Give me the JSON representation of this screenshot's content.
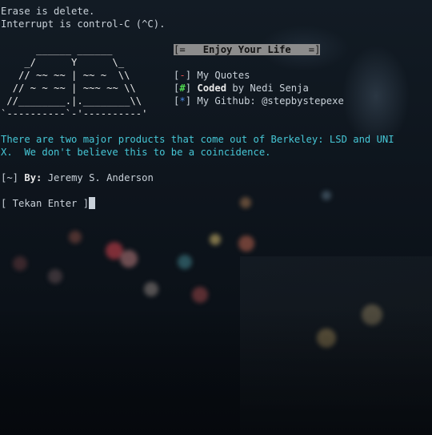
{
  "terminal": {
    "line1": "Erase is delete.",
    "line2": "Interrupt is control-C (^C).",
    "ascii_art": [
      "      ______ ______",
      "    _/      Y      \\_",
      "   // ~~ ~~ | ~~ ~  \\\\",
      "  // ~ ~ ~~ | ~~~ ~~ \\\\",
      " //________.|.________\\\\",
      "`----------`-'----------'"
    ],
    "banner": {
      "open": "[=",
      "title": "Enjoy Your Life",
      "close": "=]"
    },
    "menu": [
      {
        "bracket_open": "[",
        "mark": "-",
        "bracket_close": "]",
        "label": "My Quotes",
        "mark_color": "#e04a4a"
      },
      {
        "bracket_open": "[",
        "mark": "#",
        "bracket_close": "]",
        "label_bold": "Coded",
        "label": "by Nedi Senja",
        "mark_color": "#4fd84f"
      },
      {
        "bracket_open": "[",
        "mark": "*",
        "bracket_close": "]",
        "label": "My Github: @stepbystepexe",
        "mark_color": "#4a8bea"
      }
    ],
    "quote_line1": "There are two major products that come out of Berkeley: LSD and UNI",
    "quote_line2": "X.  We don't believe this to be a coincidence.",
    "author_prefix": "[~]",
    "author_by": "By:",
    "author_name": "Jeremy S. Anderson",
    "prompt": "[ Tekan Enter ]"
  }
}
